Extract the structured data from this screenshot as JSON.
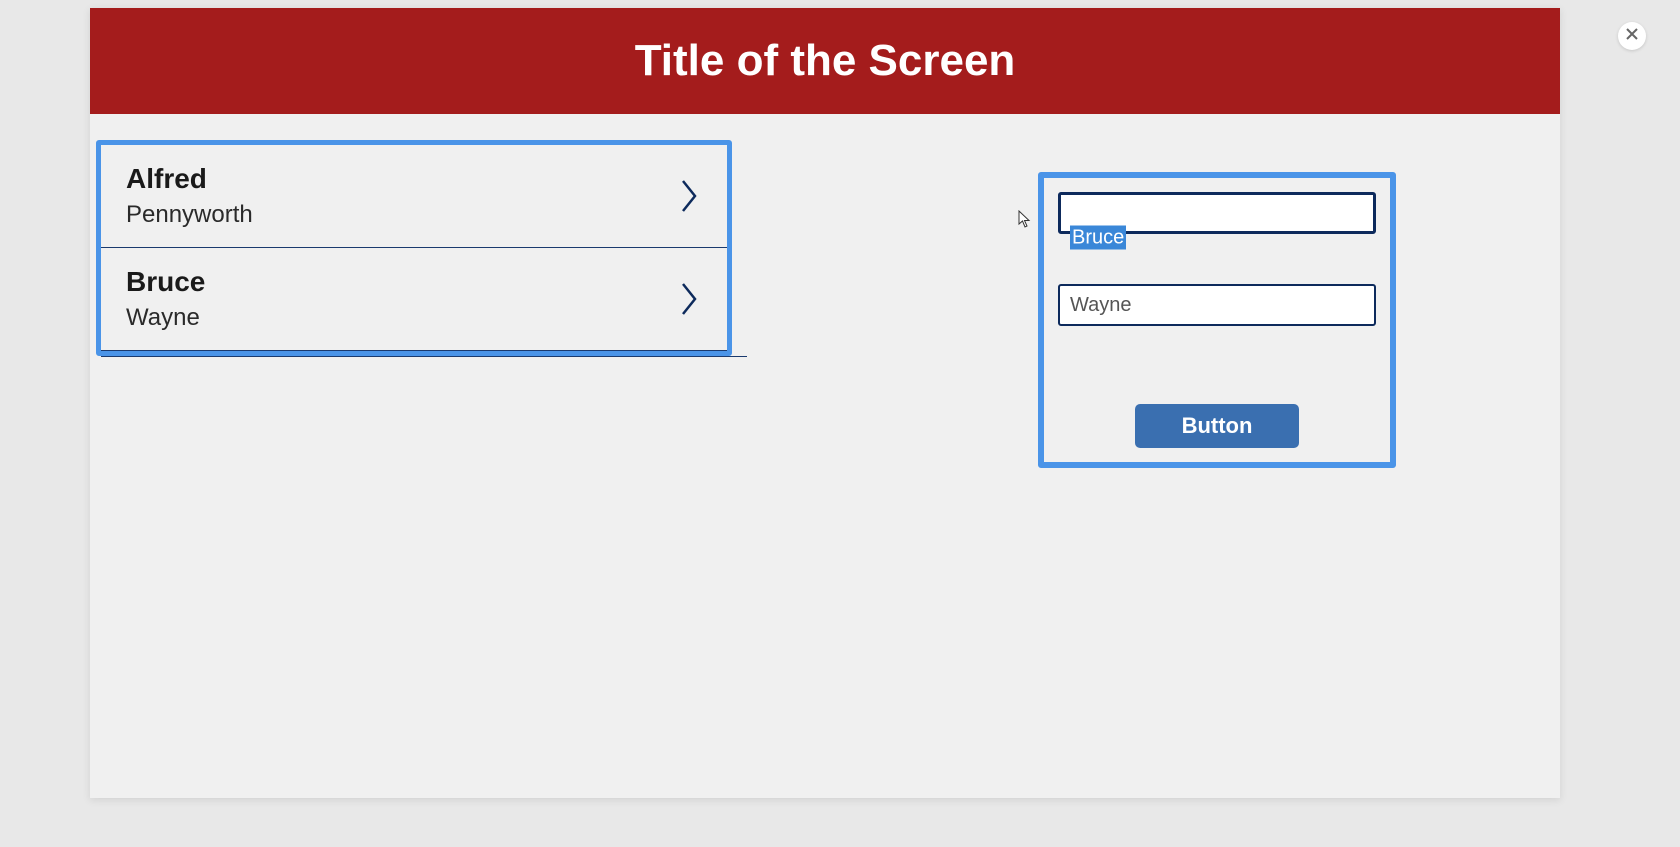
{
  "header": {
    "title": "Title of the Screen"
  },
  "list": {
    "items": [
      {
        "primary": "Alfred",
        "secondary": "Pennyworth"
      },
      {
        "primary": "Bruce",
        "secondary": "Wayne"
      }
    ]
  },
  "form": {
    "input1": "Bruce",
    "input2": "Wayne",
    "button_label": "Button"
  },
  "icons": {
    "chevron": "chevron-right-icon",
    "close": "close-icon",
    "cursor": "cursor-icon"
  },
  "colors": {
    "header_bg": "#a41c1c",
    "highlight_border": "#4a94e8",
    "dark_blue": "#0d2a5c",
    "button_bg": "#3a6fb0",
    "selection_bg": "#3a87d8"
  }
}
